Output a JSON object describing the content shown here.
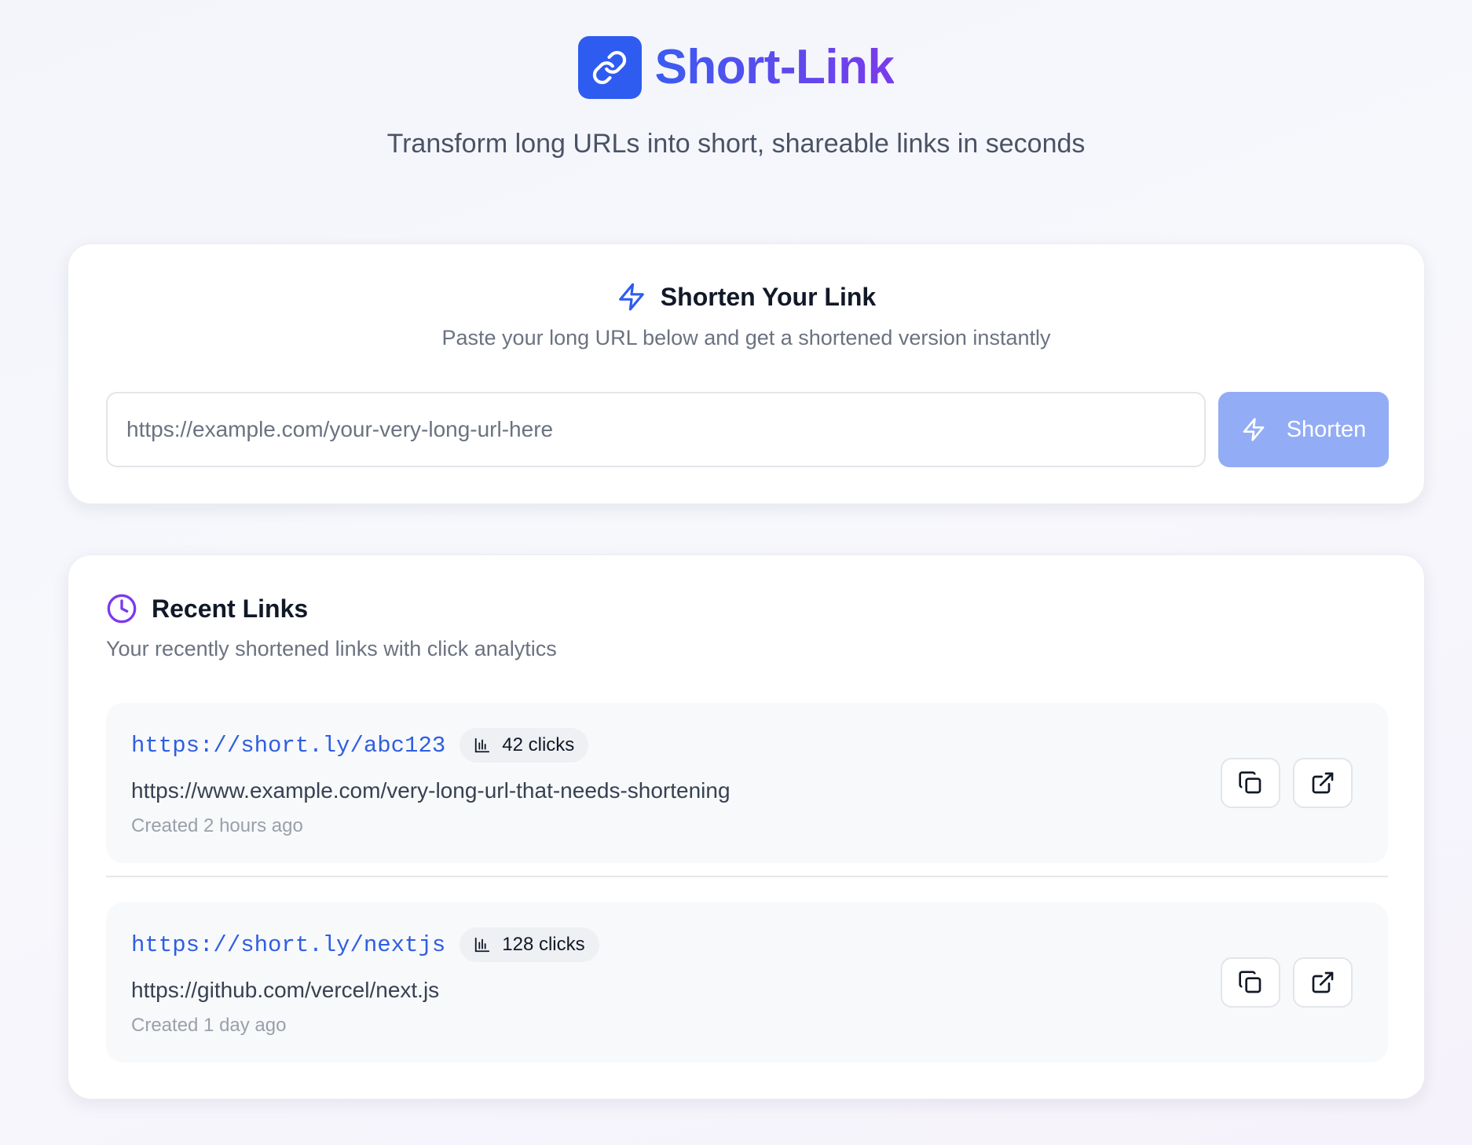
{
  "app": {
    "title": "Short-Link",
    "subtitle": "Transform long URLs into short, shareable links in seconds",
    "logo_icon": "link-icon"
  },
  "colors": {
    "primary": "#2f5cf0",
    "title_gradient_start": "#3b5cf0",
    "title_gradient_end": "#7a3bea",
    "button_disabled": "#93acf6",
    "accent_purple": "#7c3aed",
    "link_blue": "#2f5ee0"
  },
  "shorten_card": {
    "title": "Shorten Your Link",
    "title_icon": "zap-icon",
    "description": "Paste your long URL below and get a shortened version instantly",
    "input": {
      "placeholder": "https://example.com/your-very-long-url-here",
      "value": ""
    },
    "button": {
      "label": "Shorten",
      "icon": "zap-icon",
      "disabled": true
    }
  },
  "recent_card": {
    "title": "Recent Links",
    "title_icon": "clock-icon",
    "description": "Your recently shortened links with click analytics",
    "links": [
      {
        "short_url": "https://short.ly/abc123",
        "clicks": "42 clicks",
        "original_url": "https://www.example.com/very-long-url-that-needs-shortening",
        "created": "Created 2 hours ago"
      },
      {
        "short_url": "https://short.ly/nextjs",
        "clicks": "128 clicks",
        "original_url": "https://github.com/vercel/next.js",
        "created": "Created 1 day ago"
      }
    ],
    "actions": [
      "copy-icon",
      "external-link-icon"
    ]
  }
}
